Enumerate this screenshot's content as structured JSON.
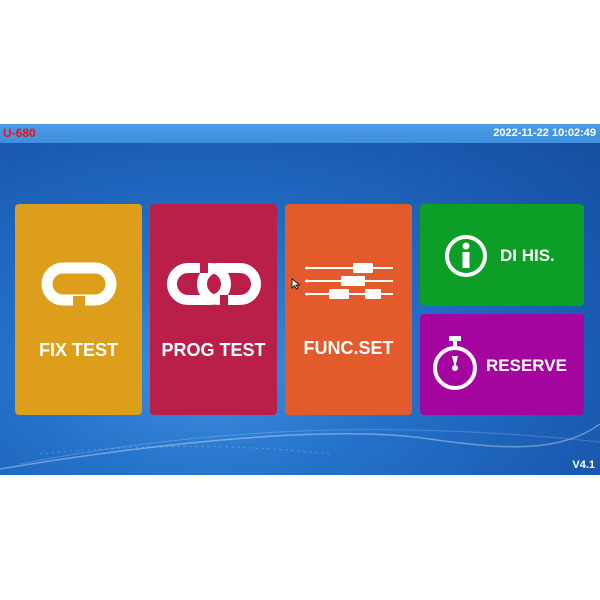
{
  "header": {
    "model": "U-680",
    "datetime": "2022-11-22 10:02:49"
  },
  "tiles": {
    "fix_test": {
      "label": "FIX TEST",
      "icon": "chain-link-icon"
    },
    "prog_test": {
      "label": "PROG TEST",
      "icon": "linked-chain-icon"
    },
    "func_set": {
      "label": "FUNC.SET",
      "icon": "sliders-icon"
    },
    "di_his": {
      "label": "DI HIS.",
      "icon": "info-icon"
    },
    "reserve": {
      "label": "RESERVE",
      "icon": "stopwatch-icon"
    }
  },
  "footer": {
    "version": "V4.1"
  },
  "colors": {
    "fix_test": "#dc9e1b",
    "prog_test": "#b91f49",
    "func_set": "#e35b2a",
    "di_his": "#0c9e27",
    "reserve": "#a5059f",
    "model_text": "#e8141c"
  }
}
